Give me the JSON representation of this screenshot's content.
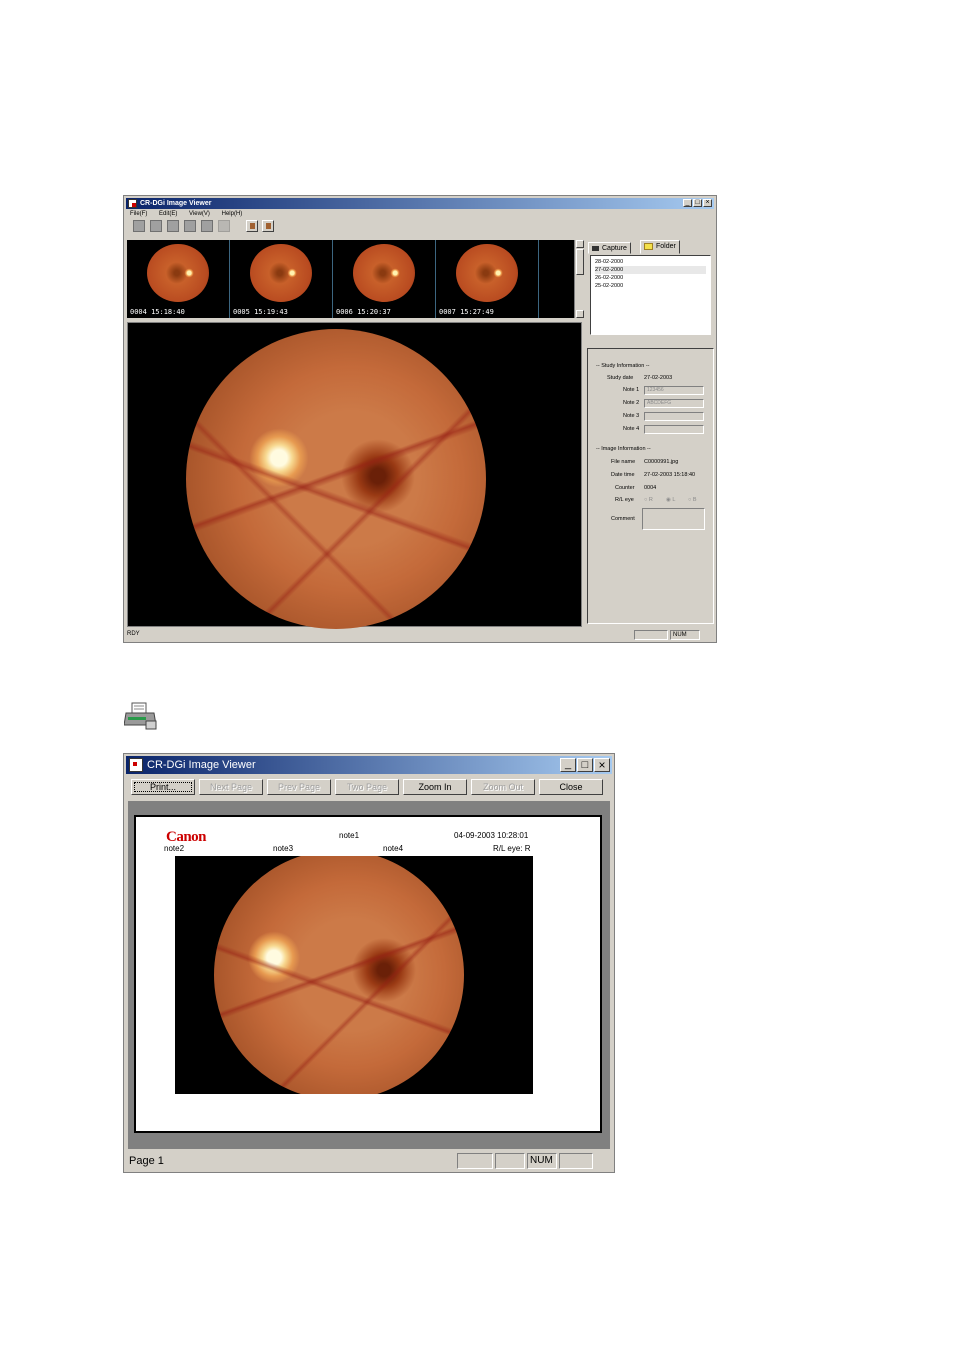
{
  "viewer": {
    "title": "CR-DGi Image Viewer",
    "menu": [
      "File(F)",
      "Edit(E)",
      "View(V)",
      "Help(H)"
    ],
    "thumbnails": [
      {
        "caption": "0004  15:18:40"
      },
      {
        "caption": "0005  15:19:43"
      },
      {
        "caption": "0006  15:20:37"
      },
      {
        "caption": "0007  15:27:49"
      }
    ],
    "tabs": {
      "capture": "Capture",
      "folder": "Folder"
    },
    "dates": [
      "28-02-2000",
      "27-02-2000",
      "26-02-2000",
      "25-02-2000"
    ],
    "study": {
      "header": "-- Study Information --",
      "date_label": "Study date",
      "date_value": "27-02-2003",
      "note1_label": "Note 1",
      "note1_value": "123456",
      "note2_label": "Note 2",
      "note2_value": "ABCDEFG",
      "note3_label": "Note 3",
      "note3_value": "",
      "note4_label": "Note 4",
      "note4_value": ""
    },
    "image": {
      "header": "-- Image Information --",
      "filename_label": "File name",
      "filename_value": "C0000991.jpg",
      "datetime_label": "Date time",
      "datetime_value": "27-02-2003 15:18:40",
      "counter_label": "Counter",
      "counter_value": "0004",
      "eye_label": "R/L eye",
      "eye_r": "R",
      "eye_l": "L",
      "eye_b": "B",
      "comment_label": "Comment"
    },
    "status": {
      "left": "RDY",
      "num": "NUM"
    }
  },
  "preview": {
    "title": "CR-DGi Image Viewer",
    "buttons": {
      "print": "Print...",
      "next": "Next Page",
      "prev": "Prev Page",
      "two": "Two Page",
      "zoom_in": "Zoom In",
      "zoom_out": "Zoom Out",
      "close": "Close"
    },
    "page": {
      "logo": "Canon",
      "note1": "note1",
      "datetime": "04-09-2003 10:28:01",
      "note2": "note2",
      "note3": "note3",
      "note4": "note4",
      "eye": "R/L eye: R"
    },
    "status": {
      "page": "Page 1",
      "num": "NUM"
    }
  }
}
